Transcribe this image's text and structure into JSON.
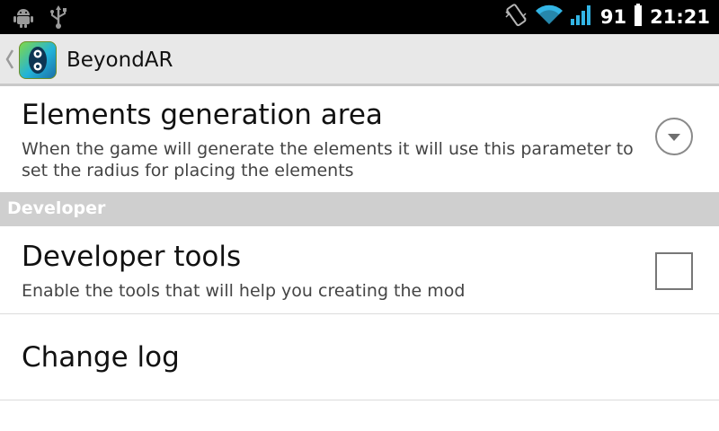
{
  "status_bar": {
    "battery_level": "91",
    "time": "21:21",
    "icons": [
      "android-debug-icon",
      "usb-icon",
      "vibrate-icon",
      "wifi-icon",
      "signal-icon",
      "battery-icon"
    ]
  },
  "action_bar": {
    "title": "BeyondAR",
    "app_icon_letter": "8"
  },
  "preferences": {
    "generation_area": {
      "title": "Elements generation area",
      "summary": "When the game will generate the elements it will use this parameter to set the radius for placing the elements"
    },
    "developer_category": {
      "label": "Developer"
    },
    "developer_tools": {
      "title": "Developer tools",
      "summary": "Enable the tools that will help you creating the mod",
      "checked": false
    },
    "change_log": {
      "title": "Change log"
    }
  },
  "colors": {
    "status_bar_bg": "#000000",
    "action_bar_bg": "#e8e8e8",
    "category_bg": "#cfcfcf",
    "wifi_signal": "#33b5e5"
  }
}
